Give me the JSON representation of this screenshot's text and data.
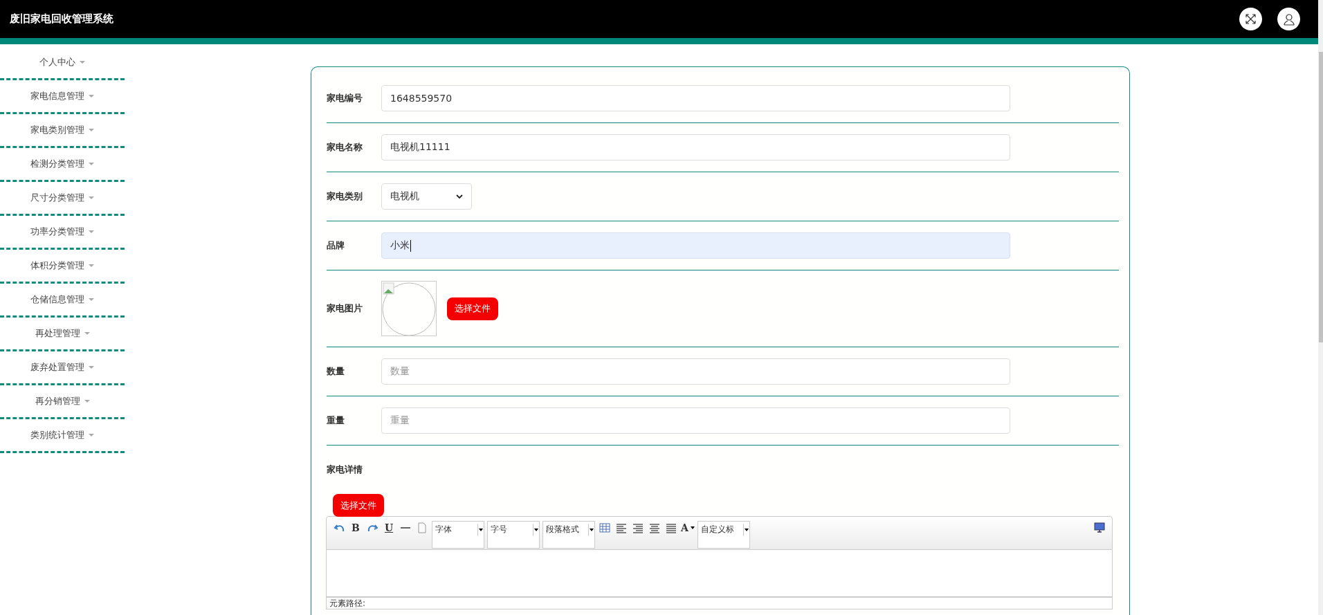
{
  "header": {
    "title": "废旧家电回收管理系统"
  },
  "sidebar": {
    "items": [
      {
        "label": "个人中心"
      },
      {
        "label": "家电信息管理"
      },
      {
        "label": "家电类别管理"
      },
      {
        "label": "检测分类管理"
      },
      {
        "label": "尺寸分类管理"
      },
      {
        "label": "功率分类管理"
      },
      {
        "label": "体积分类管理"
      },
      {
        "label": "仓储信息管理"
      },
      {
        "label": "再处理管理"
      },
      {
        "label": "废弃处置管理"
      },
      {
        "label": "再分销管理"
      },
      {
        "label": "类别统计管理"
      }
    ]
  },
  "form": {
    "fields": [
      {
        "kind": "text",
        "label": "家电编号",
        "value": "1648559570",
        "focused": false
      },
      {
        "kind": "text",
        "label": "家电名称",
        "value": "电视机11111",
        "focused": false
      },
      {
        "kind": "select",
        "label": "家电类别",
        "value": "电视机",
        "focused": false
      },
      {
        "kind": "text",
        "label": "品牌",
        "value": "小米",
        "focused": true
      },
      {
        "kind": "image",
        "label": "家电图片",
        "button": "选择文件"
      },
      {
        "kind": "text",
        "label": "数量",
        "placeholder": "数量",
        "focused": false
      },
      {
        "kind": "text",
        "label": "重量",
        "placeholder": "重量",
        "focused": false
      }
    ],
    "detail": {
      "label": "家电详情",
      "upload_button": "选择文件",
      "toolbar": [
        {
          "kind": "undo"
        },
        {
          "kind": "bold",
          "text": "B"
        },
        {
          "kind": "redo"
        },
        {
          "kind": "underline",
          "text": "U"
        },
        {
          "kind": "hr"
        },
        {
          "kind": "page"
        },
        {
          "kind": "dropdown",
          "text": "字体"
        },
        {
          "kind": "dropdown",
          "text": "字号"
        },
        {
          "kind": "dropdown",
          "text": "段落格式"
        },
        {
          "kind": "table"
        },
        {
          "kind": "align-left"
        },
        {
          "kind": "align-right"
        },
        {
          "kind": "align-center"
        },
        {
          "kind": "justify"
        },
        {
          "kind": "font-color",
          "text": "A"
        },
        {
          "kind": "dropdown",
          "text": "自定义标"
        }
      ],
      "path_label": "元素路径:"
    }
  }
}
